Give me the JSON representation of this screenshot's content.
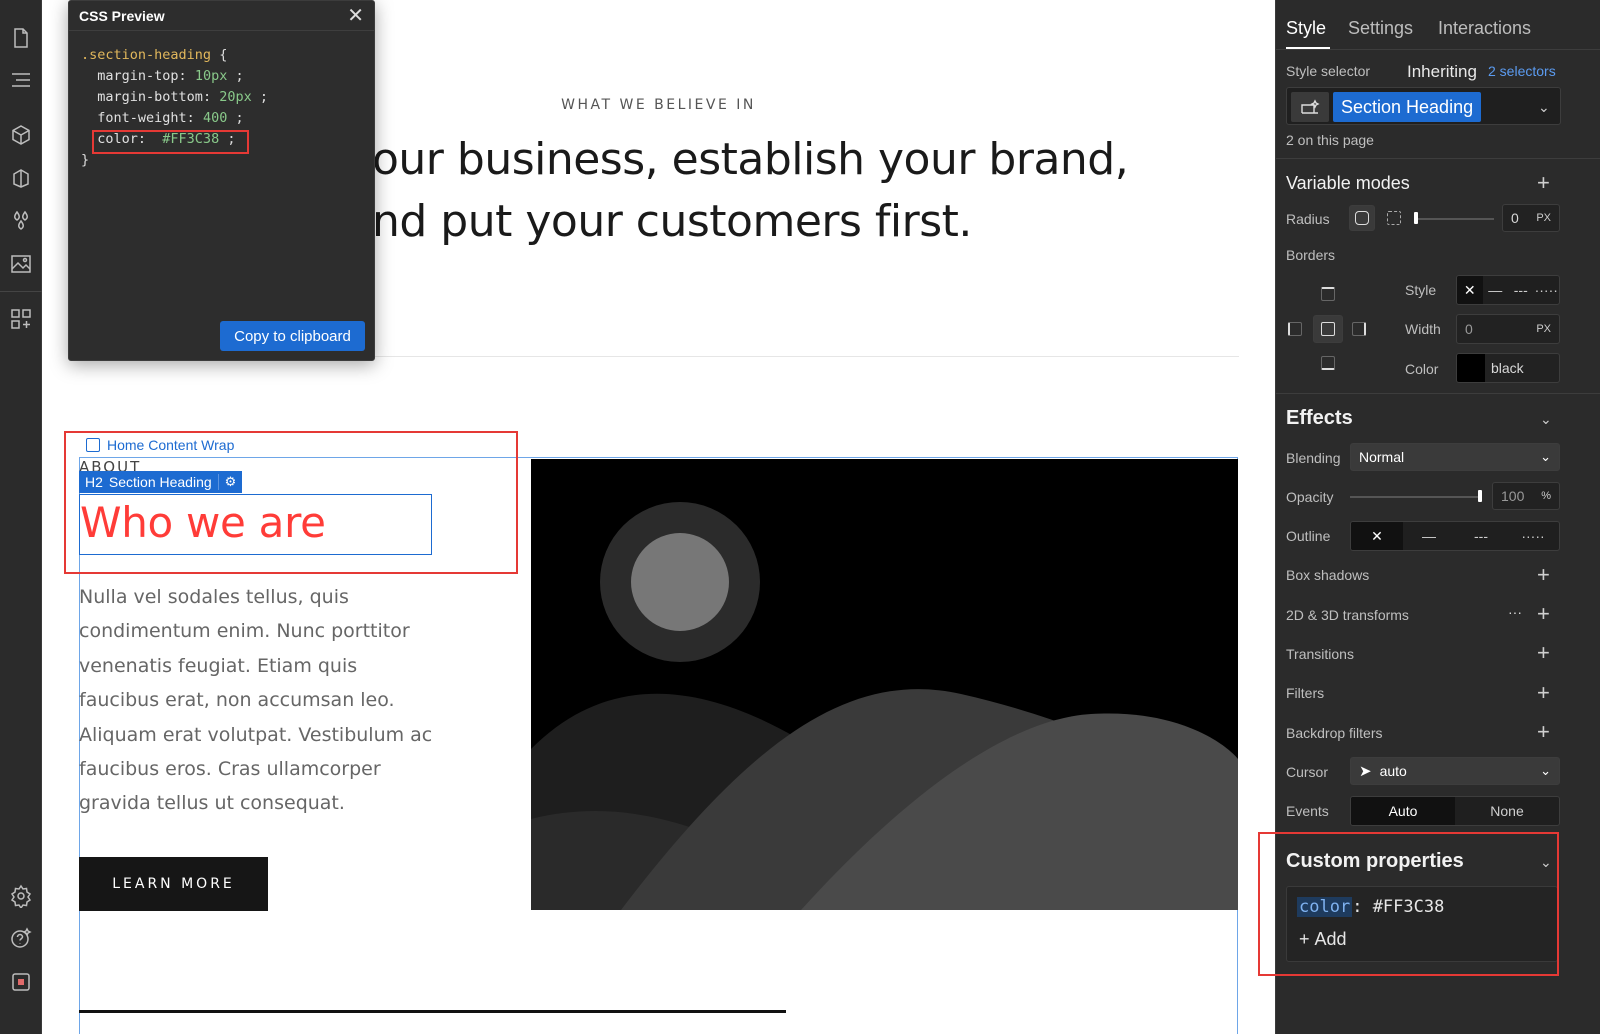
{
  "canvas": {
    "eyebrow": "WHAT WE BELIEVE IN",
    "hero_line_1": "our business, establish your brand,",
    "hero_line_2": "nd put your customers first.",
    "wrap_label": "Home Content Wrap",
    "about": "ABOUT",
    "chip_tag": "H2",
    "chip_label": "Section Heading",
    "heading": "Who we are",
    "body": "Nulla vel sodales tellus, quis condimentum enim. Nunc porttitor venenatis feugiat. Etiam quis faucibus erat, non accumsan leo. Aliquam erat volutpat. Vestibulum ac faucibus eros. Cras ullamcorper gravida tellus ut consequat.",
    "button": "LEARN MORE"
  },
  "css_preview": {
    "title": "CSS Preview",
    "selector": ".section-heading",
    "brace_open": "{",
    "brace_close": "}",
    "rules": [
      {
        "prop": "margin-top",
        "value": "10px"
      },
      {
        "prop": "margin-bottom",
        "value": "20px"
      },
      {
        "prop": "font-weight",
        "value": "400"
      },
      {
        "prop": "color",
        "value": "#FF3C38"
      }
    ],
    "copy_button": "Copy to clipboard"
  },
  "panel": {
    "tabs": [
      "Style",
      "Settings",
      "Interactions"
    ],
    "style_selector_label": "Style selector",
    "inheriting": "Inheriting",
    "inheriting_count": "2 selectors",
    "selector_name": "Section Heading",
    "on_page": "2 on this page",
    "variable_modes": "Variable modes",
    "radius_label": "Radius",
    "radius_value": "0",
    "radius_unit": "PX",
    "borders_label": "Borders",
    "border_style_label": "Style",
    "border_width_label": "Width",
    "border_width_value": "0",
    "border_width_unit": "PX",
    "border_color_label": "Color",
    "border_color_value": "black",
    "effects": "Effects",
    "blending_label": "Blending",
    "blending_value": "Normal",
    "opacity_label": "Opacity",
    "opacity_value": "100",
    "opacity_unit": "%",
    "opacity_fraction": 1.0,
    "outline_label": "Outline",
    "box_shadows": "Box shadows",
    "transforms": "2D & 3D transforms",
    "transitions": "Transitions",
    "filters": "Filters",
    "backdrop_filters": "Backdrop filters",
    "cursor_label": "Cursor",
    "cursor_value": "auto",
    "events_label": "Events",
    "events_auto": "Auto",
    "events_none": "None",
    "custom_properties": "Custom properties",
    "custom_prop_key": "color",
    "custom_prop_sep": ":",
    "custom_prop_value": "#FF3C38",
    "add_label": "Add"
  },
  "colors": {
    "heading_color": "#FF3C38",
    "accent": "#1d6bd1",
    "highlight_box": "#e53935"
  },
  "icons": {
    "left_toolbar": [
      "pages-icon",
      "navigator-icon",
      "components-icon",
      "cms-icon",
      "variables-icon",
      "assets-icon",
      "apps-icon",
      "settings-icon",
      "help-icon",
      "record-icon"
    ]
  }
}
